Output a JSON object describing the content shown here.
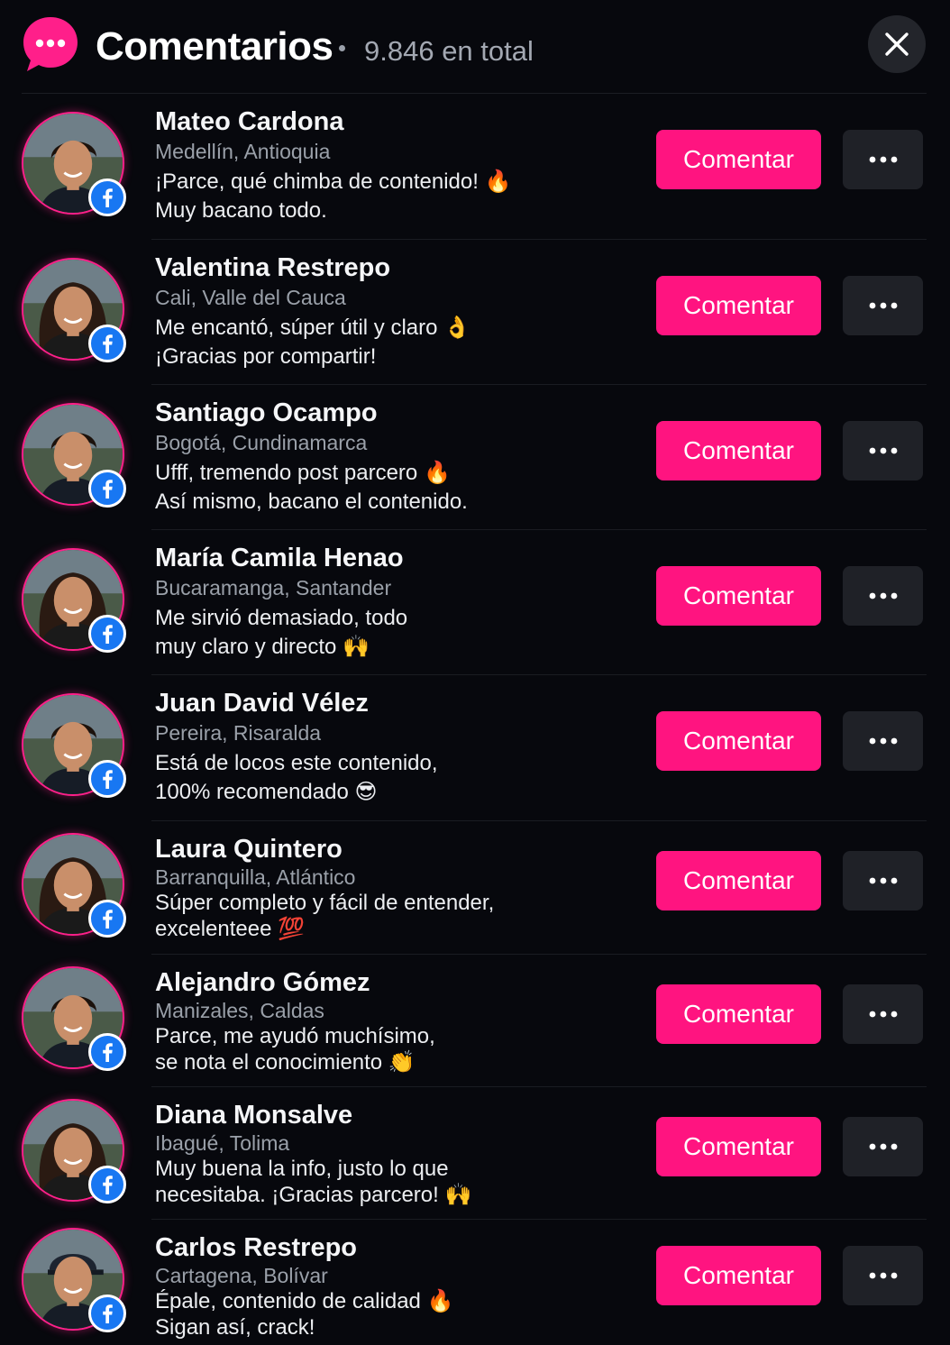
{
  "header": {
    "title": "Comentarios",
    "total": "9.846 en total",
    "icon": "chat-bubble-icon",
    "close_icon": "close-icon",
    "accent": "#ff1f8a"
  },
  "colors": {
    "background": "#07080d",
    "accent_button": "#ff1480",
    "more_button": "#1f2127",
    "facebook": "#1877f2"
  },
  "comments": [
    {
      "name": "Mateo Cardona",
      "location": "Medellín, Antioquia",
      "text": "¡Parce, qué chimba de contenido! 🔥\nMuy bacano todo.",
      "button": "Comentar",
      "avatar": "male",
      "badge": "facebook-icon"
    },
    {
      "name": "Valentina Restrepo",
      "location": "Cali, Valle del Cauca",
      "text": "Me encantó, súper útil y claro 👌\n¡Gracias por compartir!",
      "button": "Comentar",
      "avatar": "female",
      "badge": "facebook-icon"
    },
    {
      "name": "Santiago Ocampo",
      "location": "Bogotá, Cundinamarca",
      "text": "Ufff, tremendo post parcero 🔥\nAsí mismo, bacano el contenido.",
      "button": "Comentar",
      "avatar": "male",
      "badge": "facebook-icon"
    },
    {
      "name": "María Camila Henao",
      "location": "Bucaramanga, Santander",
      "text": "Me sirvió demasiado, todo\nmuy claro y directo 🙌",
      "button": "Comentar",
      "avatar": "female",
      "badge": "facebook-icon"
    },
    {
      "name": "Juan David Vélez",
      "location": "Pereira, Risaralda",
      "text": "Está de locos este contenido,\n100% recomendado 😎",
      "button": "Comentar",
      "avatar": "male",
      "badge": "facebook-icon"
    },
    {
      "name": "Laura Quintero",
      "location": "Barranquilla, Atlántico",
      "text": "Súper completo y fácil de entender,\nexcelenteee 💯",
      "button": "Comentar",
      "avatar": "female",
      "badge": "facebook-icon"
    },
    {
      "name": "Alejandro Gómez",
      "location": "Manizales, Caldas",
      "text": "Parce, me ayudó muchísimo,\nse nota el conocimiento 👏",
      "button": "Comentar",
      "avatar": "male",
      "badge": "facebook-icon"
    },
    {
      "name": "Diana Monsalve",
      "location": "Ibagué, Tolima",
      "text": "Muy buena la info, justo lo que\nnecesitaba. ¡Gracias parcero! 🙌",
      "button": "Comentar",
      "avatar": "female",
      "badge": "facebook-icon"
    },
    {
      "name": "Carlos Restrepo",
      "location": "Cartagena, Bolívar",
      "text": "Épale, contenido de calidad 🔥\nSigan así, crack!",
      "button": "Comentar",
      "avatar": "male-cap",
      "badge": "facebook-icon"
    }
  ]
}
